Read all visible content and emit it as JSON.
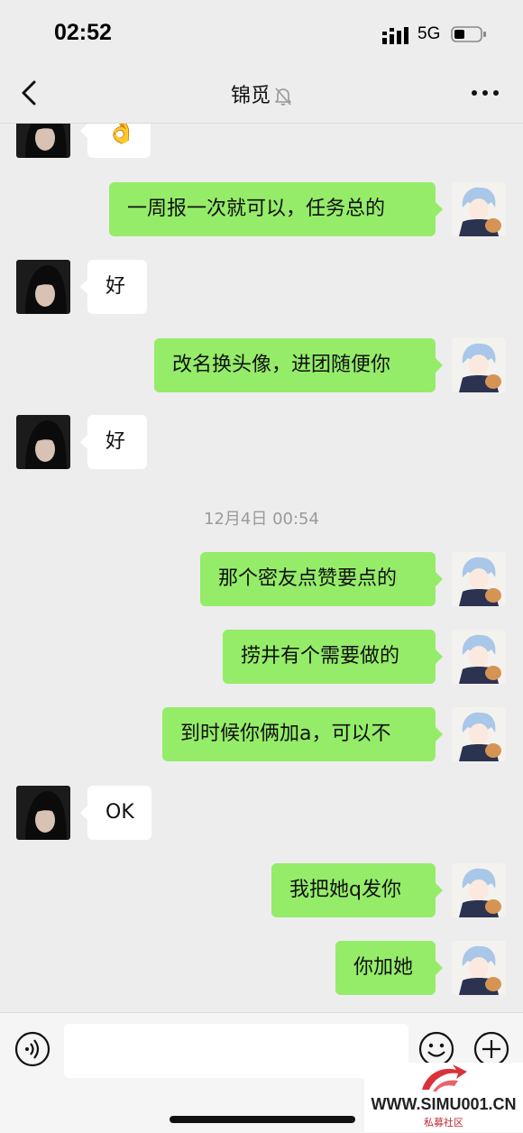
{
  "status_bar": {
    "time": "02:52",
    "network": "5G",
    "icons": [
      "signal-icon",
      "battery-icon"
    ]
  },
  "nav": {
    "title": "锦觅",
    "icons": [
      "back-icon",
      "mute-bell-icon",
      "more-icon"
    ]
  },
  "messages": [
    {
      "side": "in",
      "text": "👌",
      "avatar": "female-avatar"
    },
    {
      "side": "out",
      "text": "一周报一次就可以，任务总的",
      "avatar": "anime-boy-avatar"
    },
    {
      "side": "in",
      "text": "好",
      "avatar": "female-avatar"
    },
    {
      "side": "out",
      "text": "改名换头像，进团随便你",
      "avatar": "anime-boy-avatar"
    },
    {
      "side": "in",
      "text": "好",
      "avatar": "female-avatar"
    },
    {
      "side": "time",
      "text": "12月4日 00:54"
    },
    {
      "side": "out",
      "text": "那个密友点赞要点的",
      "avatar": "anime-boy-avatar"
    },
    {
      "side": "out",
      "text": "捞井有个需要做的",
      "avatar": "anime-boy-avatar"
    },
    {
      "side": "out",
      "text": "到时候你俩加a，可以不",
      "avatar": "anime-boy-avatar"
    },
    {
      "side": "in",
      "text": "OK",
      "avatar": "female-avatar"
    },
    {
      "side": "out",
      "text": "我把她q发你",
      "avatar": "anime-boy-avatar"
    },
    {
      "side": "out",
      "text": "你加她",
      "avatar": "anime-boy-avatar"
    }
  ],
  "input_bar": {
    "text_value": "",
    "icons": [
      "voice-icon",
      "emoji-icon",
      "plus-icon"
    ]
  },
  "watermark": {
    "text": "WWW.SIMU001.CN",
    "subtext": "私募社区"
  },
  "colors": {
    "background": "#ededed",
    "outgoing_bubble": "#95ec69",
    "incoming_bubble": "#ffffff",
    "timestamp": "#9a9a9a"
  }
}
